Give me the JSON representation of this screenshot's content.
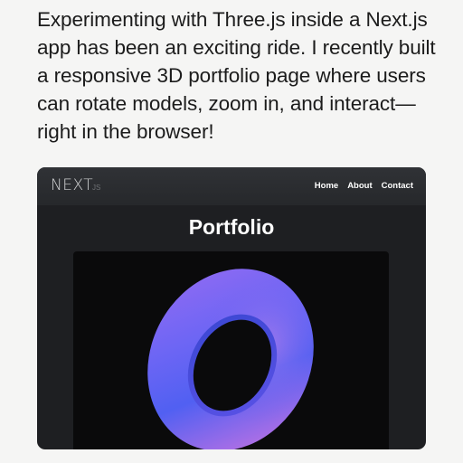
{
  "post": {
    "text": "Experimenting with Three.js inside a Next.js\napp has been an exciting ride. I recently built\na responsive 3D portfolio page where users\ncan rotate models, zoom in, and interact—\nright in the browser!"
  },
  "app": {
    "logo": "NEXT",
    "logo_sub": "JS",
    "nav": [
      "Home",
      "About",
      "Contact"
    ],
    "page_title": "Portfolio"
  },
  "viewer": {
    "model": "torus",
    "colors": {
      "light": "#b16ee0",
      "mid": "#8a60f0",
      "dark": "#4b62f0",
      "hole_edge": "#3d4fd8",
      "background": "#0a0a0b"
    }
  }
}
